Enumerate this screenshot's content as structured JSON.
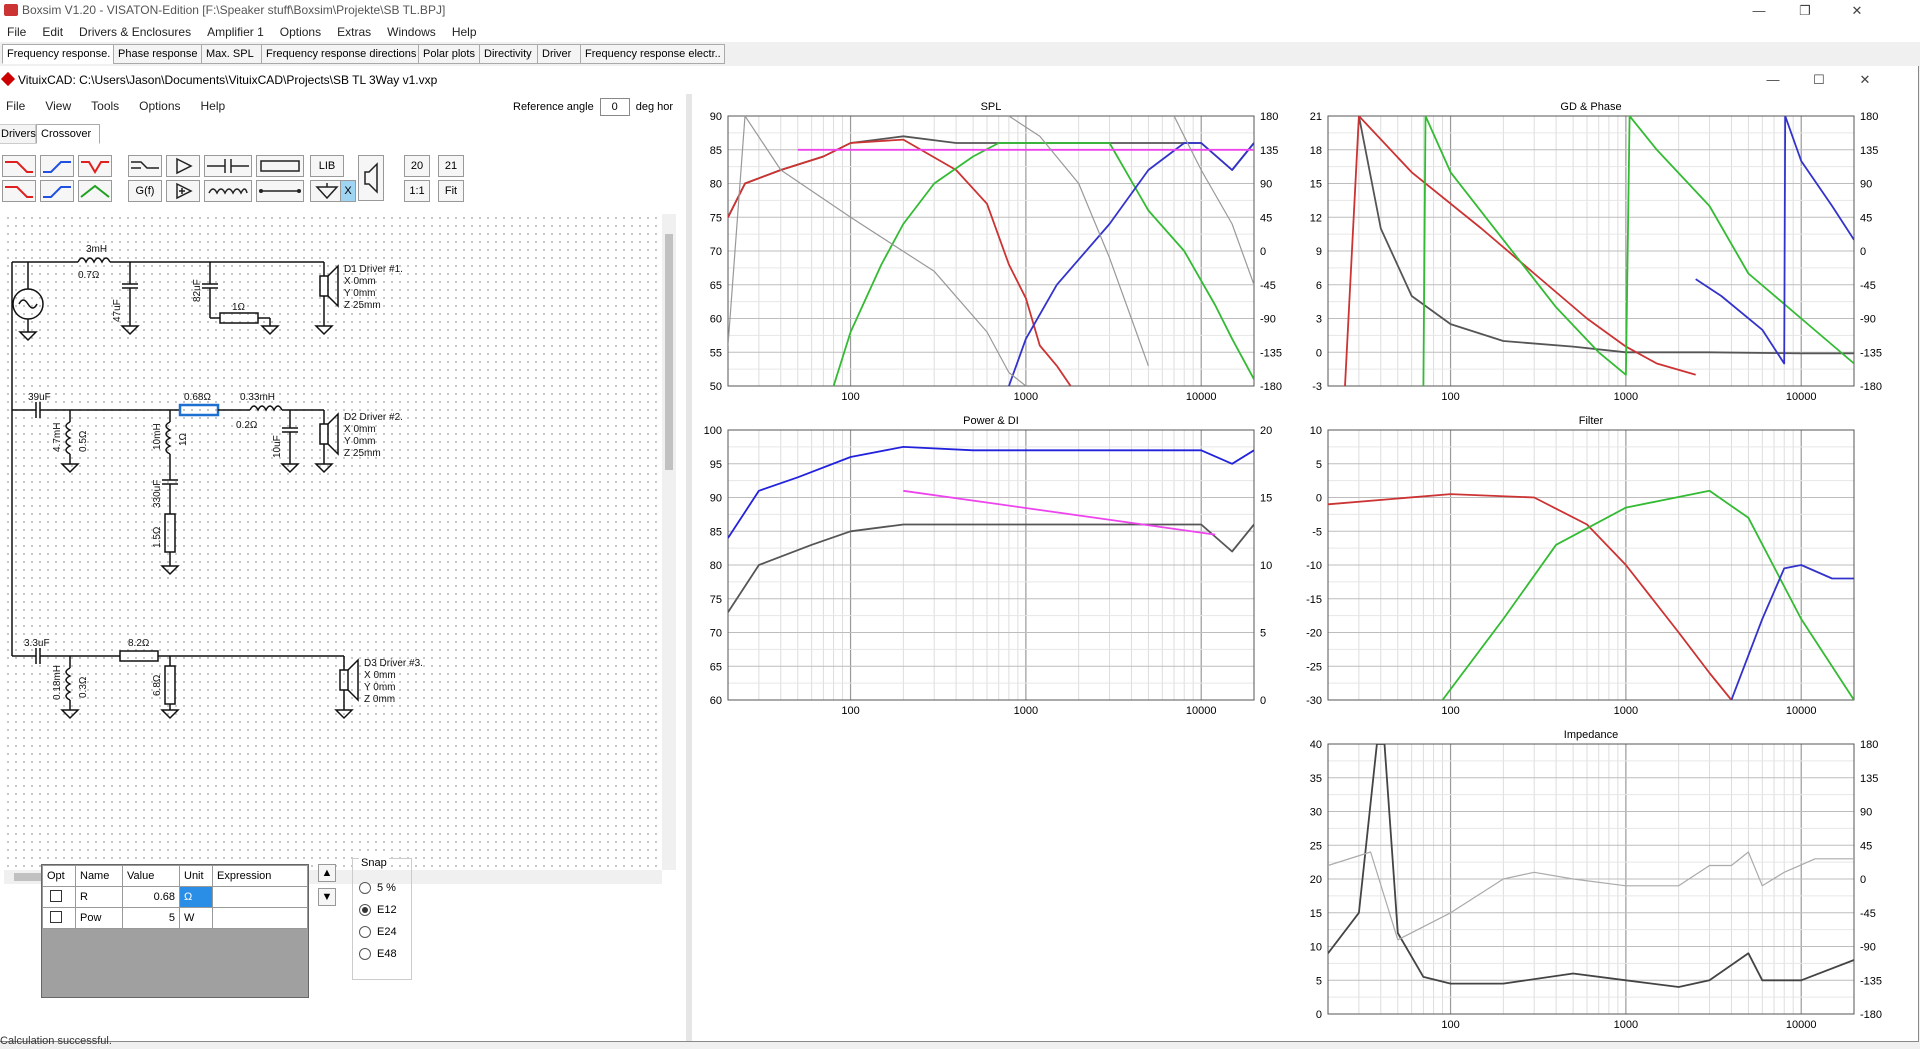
{
  "boxsim": {
    "title": "Boxsim V1.20 - VISATON-Edition [F:\\Speaker stuff\\Boxsim\\Projekte\\SB TL.BPJ]",
    "menu": [
      "File",
      "Edit",
      "Drivers & Enclosures",
      "Amplifier 1",
      "Options",
      "Extras",
      "Windows",
      "Help"
    ],
    "tabs": [
      "Frequency response.",
      "Phase response",
      "Max. SPL",
      "Frequency response directions",
      "Polar plots",
      "Directivity",
      "Driver",
      "Frequency response electr.."
    ]
  },
  "vituix": {
    "title": "VituixCAD: C:\\Users\\Jason\\Documents\\VituixCAD\\Projects\\SB TL 3Way v1.vxp",
    "menu": [
      "File",
      "View",
      "Tools",
      "Options",
      "Help"
    ],
    "reference_angle_label": "Reference angle",
    "reference_angle_value": "0",
    "reference_angle_unit": "deg hor",
    "subtabs": [
      "Drivers",
      "Crossover"
    ],
    "toolbar": {
      "lib": "LIB",
      "gf": "G(f)",
      "x": "X",
      "n20": "20",
      "n21": "21",
      "one_to_one": "1:1",
      "fit": "Fit"
    },
    "schematic": {
      "b1": {
        "inductor": "3mH",
        "inductor_r": "0.7Ω",
        "cap1": "47uF",
        "cap2": "82uF",
        "res": "1Ω",
        "driver": "D1 Driver #1.",
        "x": "X 0mm",
        "y": "Y 0mm",
        "z": "Z 25mm"
      },
      "b2": {
        "cap": "39uF",
        "shunt_l": "4.7mH",
        "shunt_r": "0.5Ω",
        "series_r": "0.68Ω",
        "series_l": "0.33mH",
        "series_l_r": "0.2Ω",
        "mid_l": "10mH",
        "mid_l_r": "1Ω",
        "mid_c": "330uF",
        "mid_r": "1.5Ω",
        "out_c": "10uF",
        "driver": "D2 Driver #2.",
        "x": "X 0mm",
        "y": "Y 0mm",
        "z": "Z 25mm"
      },
      "b3": {
        "cap": "3.3uF",
        "shunt_l": "0.18mH",
        "shunt_r": "0.3Ω",
        "series_r": "8.2Ω",
        "shunt_r2": "6.8Ω",
        "driver": "D3 Driver #3.",
        "x": "X 0mm",
        "y": "Y 0mm",
        "z": "Z 0mm"
      }
    },
    "properties": {
      "headers": [
        "Opt",
        "Name",
        "Value",
        "Unit",
        "Expression"
      ],
      "rows": [
        {
          "name": "R",
          "value": "0.68",
          "unit": "Ω",
          "expression": ""
        },
        {
          "name": "Pow",
          "value": "5",
          "unit": "W",
          "expression": ""
        }
      ]
    },
    "snap": {
      "label": "Snap",
      "options": [
        "5 %",
        "E12",
        "E24",
        "E48"
      ],
      "selected": "E12"
    },
    "status": "Calculation successful."
  },
  "chart_data": [
    {
      "type": "line",
      "title": "SPL",
      "x_scale": "log",
      "xlim": [
        20,
        20000
      ],
      "ylim": [
        50,
        90
      ],
      "y2lim": [
        -180,
        180
      ],
      "x_ticks": [
        "100",
        "1000",
        "10000"
      ],
      "y_ticks": [
        "50",
        "55",
        "60",
        "65",
        "70",
        "75",
        "80",
        "85",
        "90"
      ],
      "y2_ticks": [
        "-180",
        "-135",
        "-90",
        "-45",
        "0",
        "45",
        "90",
        "135",
        "180"
      ],
      "series": [
        {
          "color": "#555555",
          "points": [
            [
              20,
              75
            ],
            [
              25,
              80
            ],
            [
              40,
              82
            ],
            [
              70,
              84
            ],
            [
              100,
              86
            ],
            [
              200,
              87
            ],
            [
              400,
              86
            ],
            [
              1000,
              86
            ],
            [
              3000,
              86
            ],
            [
              8000,
              86
            ],
            [
              10000,
              86
            ],
            [
              15000,
              82
            ],
            [
              20000,
              86
            ]
          ]
        },
        {
          "color": "#cc3333",
          "points": [
            [
              20,
              75
            ],
            [
              25,
              80
            ],
            [
              40,
              82
            ],
            [
              70,
              84
            ],
            [
              100,
              86
            ],
            [
              200,
              86.5
            ],
            [
              400,
              82
            ],
            [
              600,
              77
            ],
            [
              800,
              68
            ],
            [
              1000,
              63
            ],
            [
              1200,
              56
            ],
            [
              1500,
              53
            ],
            [
              1800,
              50
            ]
          ]
        },
        {
          "color": "#33bb33",
          "points": [
            [
              80,
              50
            ],
            [
              100,
              58
            ],
            [
              150,
              68
            ],
            [
              200,
              74
            ],
            [
              300,
              80
            ],
            [
              500,
              84
            ],
            [
              700,
              86
            ],
            [
              1000,
              86
            ],
            [
              3000,
              86
            ],
            [
              5000,
              76
            ],
            [
              8000,
              70
            ],
            [
              12000,
              62
            ],
            [
              15000,
              57
            ],
            [
              20000,
              51
            ]
          ]
        },
        {
          "color": "#3333cc",
          "points": [
            [
              800,
              50
            ],
            [
              1000,
              57
            ],
            [
              1500,
              65
            ],
            [
              3000,
              74
            ],
            [
              5000,
              82
            ],
            [
              8000,
              86
            ],
            [
              10000,
              86
            ],
            [
              15000,
              82
            ],
            [
              20000,
              86
            ]
          ]
        },
        {
          "color": "#ee44ee",
          "points": [
            [
              50,
              85
            ],
            [
              20000,
              85
            ]
          ]
        },
        {
          "color": "#999999",
          "points": [
            [
              20,
              56
            ],
            [
              25,
              90
            ],
            [
              40,
              82
            ],
            [
              100,
              75
            ],
            [
              300,
              67
            ],
            [
              600,
              58
            ],
            [
              800,
              52
            ],
            [
              1000,
              50
            ]
          ]
        },
        {
          "color": "#999999",
          "points": [
            [
              800,
              90
            ],
            [
              1200,
              87
            ],
            [
              2000,
              80
            ],
            [
              3000,
              69
            ],
            [
              4000,
              60
            ],
            [
              5000,
              53
            ]
          ]
        },
        {
          "color": "#999999",
          "points": [
            [
              7000,
              90
            ],
            [
              8000,
              87
            ],
            [
              10000,
              82
            ],
            [
              15000,
              74
            ],
            [
              20000,
              65
            ]
          ]
        }
      ]
    },
    {
      "type": "line",
      "title": "GD & Phase",
      "x_scale": "log",
      "xlim": [
        20,
        20000
      ],
      "ylim": [
        -3,
        21
      ],
      "y2lim": [
        -180,
        180
      ],
      "x_ticks": [
        "100",
        "1000",
        "10000"
      ],
      "y_ticks": [
        "-3",
        "0",
        "3",
        "6",
        "9",
        "12",
        "15",
        "18",
        "21"
      ],
      "y2_ticks": [
        "-180",
        "-135",
        "-90",
        "-45",
        "0",
        "45",
        "90",
        "135",
        "180"
      ],
      "series": [
        {
          "color": "#555555",
          "points": [
            [
              30,
              21
            ],
            [
              40,
              11
            ],
            [
              60,
              5
            ],
            [
              100,
              2.5
            ],
            [
              200,
              1
            ],
            [
              500,
              0.5
            ],
            [
              1000,
              0
            ],
            [
              3000,
              0
            ],
            [
              10000,
              -0.1
            ],
            [
              20000,
              -0.1
            ]
          ]
        },
        {
          "color": "#cc3333",
          "points": [
            [
              25,
              -3
            ],
            [
              30,
              21
            ],
            [
              60,
              16
            ],
            [
              150,
              11
            ],
            [
              300,
              7
            ],
            [
              600,
              3
            ],
            [
              1000,
              0.5
            ],
            [
              1500,
              -1
            ],
            [
              2500,
              -2
            ]
          ]
        },
        {
          "color": "#33bb33",
          "points": [
            [
              70,
              -3
            ],
            [
              72,
              21
            ],
            [
              100,
              16
            ],
            [
              200,
              10
            ],
            [
              400,
              4
            ],
            [
              700,
              0
            ],
            [
              1000,
              -2
            ],
            [
              1050,
              21
            ],
            [
              1500,
              18
            ],
            [
              3000,
              13
            ],
            [
              5000,
              7
            ],
            [
              10000,
              3
            ],
            [
              20000,
              -1
            ]
          ]
        },
        {
          "color": "#3333cc",
          "points": [
            [
              2500,
              6.5
            ],
            [
              3500,
              5
            ],
            [
              6000,
              2
            ],
            [
              8000,
              -1
            ],
            [
              8100,
              21
            ],
            [
              10000,
              17
            ],
            [
              15000,
              13
            ],
            [
              20000,
              10
            ]
          ]
        }
      ]
    },
    {
      "type": "line",
      "title": "Power & DI",
      "x_scale": "log",
      "xlim": [
        20,
        20000
      ],
      "ylim": [
        60,
        100
      ],
      "y2lim": [
        0,
        20
      ],
      "x_ticks": [
        "100",
        "1000",
        "10000"
      ],
      "y_ticks": [
        "60",
        "65",
        "70",
        "75",
        "80",
        "85",
        "90",
        "95",
        "100"
      ],
      "y2_ticks": [
        "0",
        "5",
        "10",
        "15",
        "20"
      ],
      "series": [
        {
          "color": "#2222dd",
          "points": [
            [
              20,
              84
            ],
            [
              30,
              91
            ],
            [
              50,
              93
            ],
            [
              100,
              96
            ],
            [
              200,
              97.5
            ],
            [
              500,
              97
            ],
            [
              1000,
              97
            ],
            [
              3000,
              97
            ],
            [
              10000,
              97
            ],
            [
              15000,
              95
            ],
            [
              20000,
              97
            ]
          ]
        },
        {
          "color": "#555555",
          "points": [
            [
              20,
              73
            ],
            [
              30,
              80
            ],
            [
              60,
              83
            ],
            [
              100,
              85
            ],
            [
              200,
              86
            ],
            [
              500,
              86
            ],
            [
              1000,
              86
            ],
            [
              3000,
              86
            ],
            [
              10000,
              86
            ],
            [
              15000,
              82
            ],
            [
              20000,
              86
            ]
          ]
        },
        {
          "color": "#ee44ee",
          "points": [
            [
              200,
              91
            ],
            [
              12000,
              84.5
            ]
          ]
        }
      ]
    },
    {
      "type": "line",
      "title": "Filter",
      "x_scale": "log",
      "xlim": [
        20,
        20000
      ],
      "ylim": [
        -30,
        10
      ],
      "x_ticks": [
        "100",
        "1000",
        "10000"
      ],
      "y_ticks": [
        "-30",
        "-25",
        "-20",
        "-15",
        "-10",
        "-5",
        "0",
        "5",
        "10"
      ],
      "series": [
        {
          "color": "#cc3333",
          "points": [
            [
              20,
              -1
            ],
            [
              100,
              0.5
            ],
            [
              300,
              0
            ],
            [
              600,
              -4
            ],
            [
              1000,
              -10
            ],
            [
              2000,
              -20
            ],
            [
              3000,
              -26
            ],
            [
              4000,
              -30
            ]
          ]
        },
        {
          "color": "#33bb33",
          "points": [
            [
              90,
              -30
            ],
            [
              200,
              -18
            ],
            [
              400,
              -7
            ],
            [
              1000,
              -1.5
            ],
            [
              3000,
              1
            ],
            [
              5000,
              -3
            ],
            [
              10000,
              -18
            ],
            [
              20000,
              -30
            ]
          ]
        },
        {
          "color": "#3333cc",
          "points": [
            [
              4000,
              -30
            ],
            [
              6000,
              -18
            ],
            [
              8000,
              -10.5
            ],
            [
              10000,
              -10
            ],
            [
              15000,
              -12
            ],
            [
              20000,
              -12
            ]
          ]
        }
      ]
    },
    {
      "type": "line",
      "title": "Impedance",
      "x_scale": "log",
      "xlim": [
        20,
        20000
      ],
      "ylim": [
        0,
        40
      ],
      "y2lim": [
        -180,
        180
      ],
      "x_ticks": [
        "100",
        "1000",
        "10000"
      ],
      "y_ticks": [
        "0",
        "5",
        "10",
        "15",
        "20",
        "25",
        "30",
        "35",
        "40"
      ],
      "y2_ticks": [
        "-180",
        "-135",
        "-90",
        "-45",
        "0",
        "45",
        "90",
        "135",
        "180"
      ],
      "series": [
        {
          "color": "#444444",
          "points": [
            [
              20,
              9
            ],
            [
              30,
              15
            ],
            [
              38,
              40
            ],
            [
              42,
              40
            ],
            [
              50,
              12
            ],
            [
              70,
              5.5
            ],
            [
              100,
              4.5
            ],
            [
              200,
              4.5
            ],
            [
              500,
              6
            ],
            [
              1000,
              5
            ],
            [
              2000,
              4
            ],
            [
              3000,
              5
            ],
            [
              5000,
              9
            ],
            [
              6000,
              5
            ],
            [
              10000,
              5
            ],
            [
              20000,
              8
            ]
          ]
        },
        {
          "color": "#aaaaaa",
          "points": [
            [
              20,
              22
            ],
            [
              35,
              24
            ],
            [
              50,
              11
            ],
            [
              100,
              15
            ],
            [
              200,
              20
            ],
            [
              300,
              21
            ],
            [
              500,
              20
            ],
            [
              1000,
              19
            ],
            [
              2000,
              19
            ],
            [
              3000,
              22
            ],
            [
              4000,
              22
            ],
            [
              5000,
              24
            ],
            [
              6000,
              19
            ],
            [
              8000,
              21
            ],
            [
              12000,
              23
            ],
            [
              20000,
              23
            ]
          ]
        }
      ]
    }
  ]
}
